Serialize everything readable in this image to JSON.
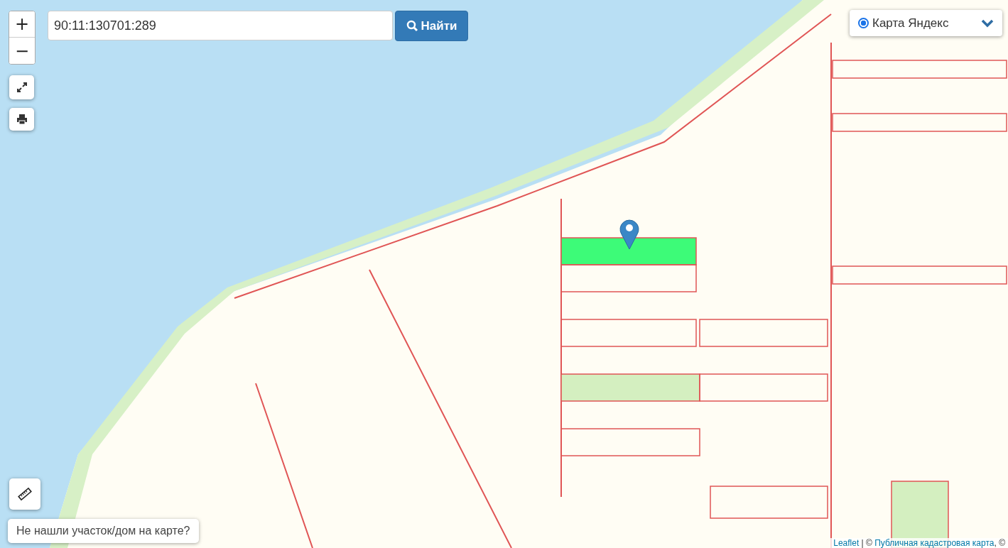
{
  "zoom_controls": {
    "zoom_in": "+",
    "zoom_out": "−"
  },
  "search": {
    "value": "90:11:130701:289",
    "button": "Найти"
  },
  "layer_switcher": {
    "label": "Карта Яндекс",
    "selected": true
  },
  "marker": {
    "shown": true
  },
  "help_button": "Не нашли участок/дом на карте?",
  "attribution": [
    {
      "kind": "link",
      "text": "Leaflet"
    },
    {
      "kind": "text",
      "text": " | © "
    },
    {
      "kind": "link",
      "text": "Публичная кадастровая карта"
    },
    {
      "kind": "text",
      "text": ", ©"
    }
  ]
}
